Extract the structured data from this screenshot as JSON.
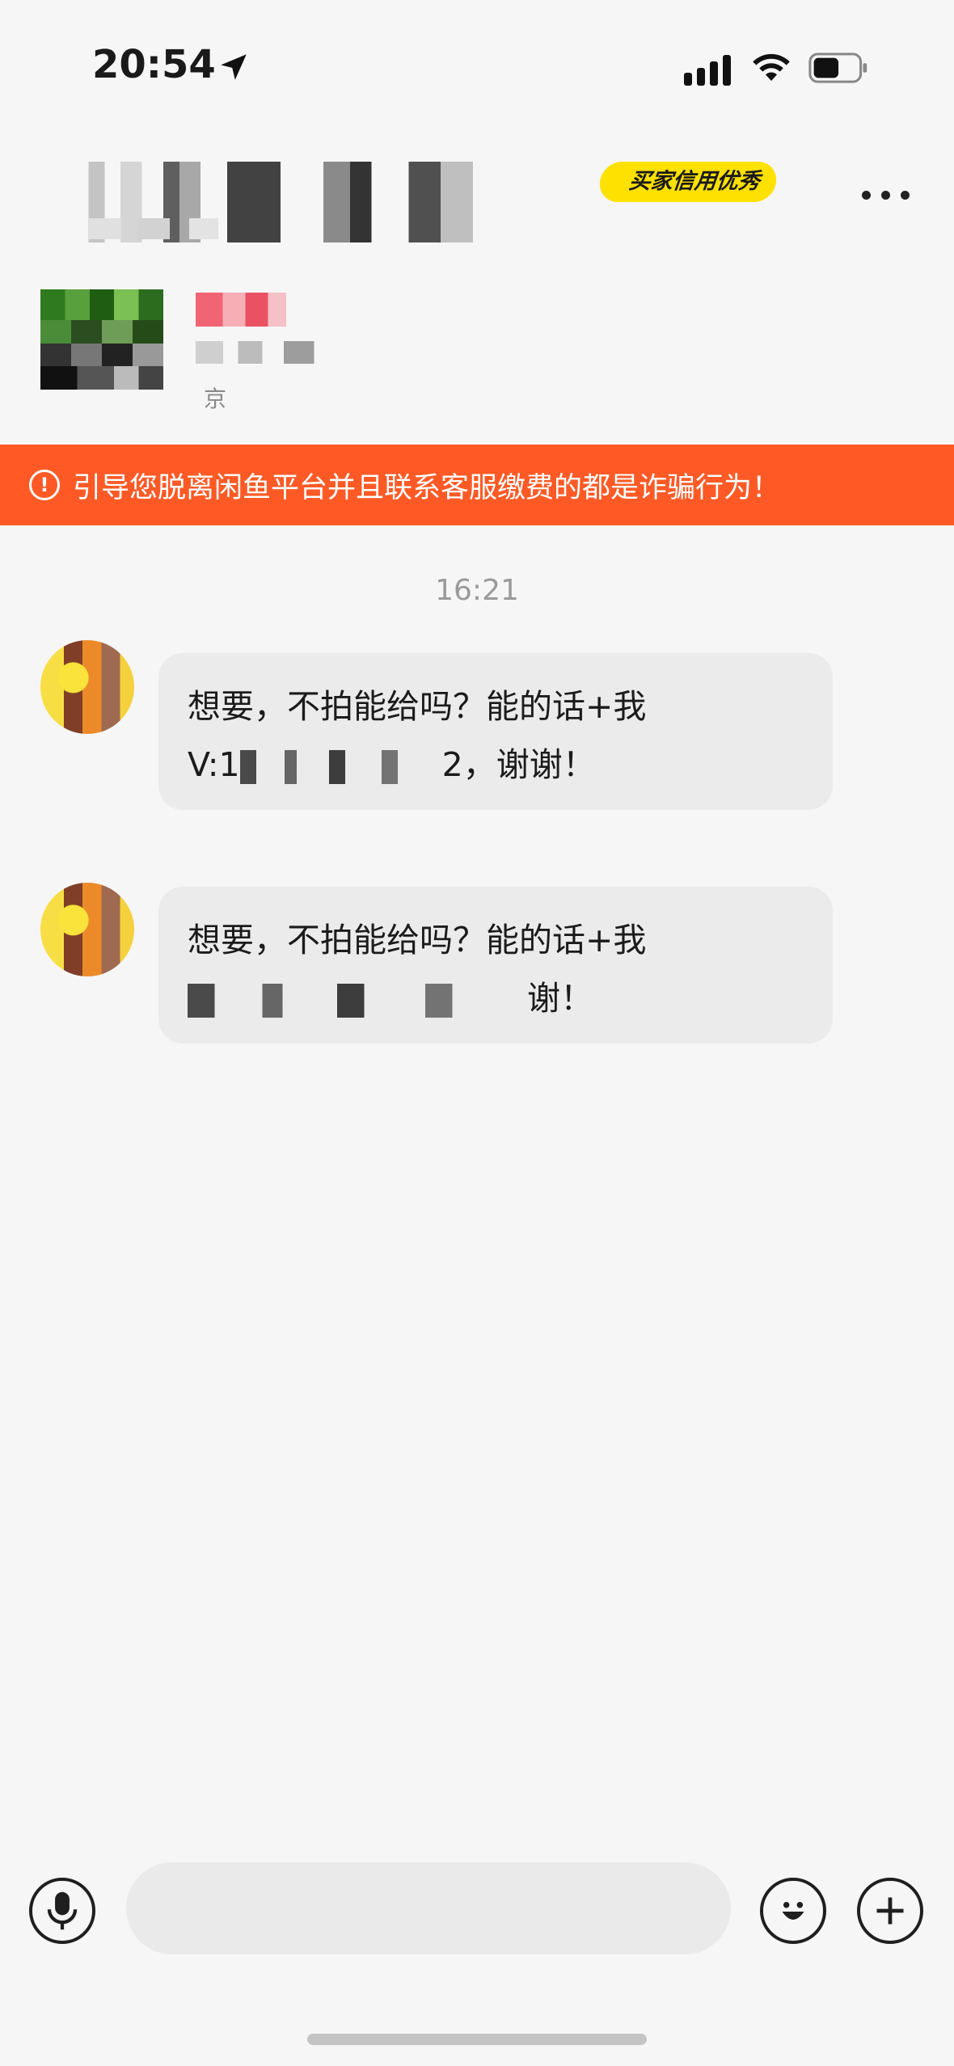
{
  "status_bar": {
    "time": "20:54",
    "icons": [
      "location-arrow-icon",
      "cellular-signal-icon",
      "wifi-icon",
      "battery-icon"
    ]
  },
  "header": {
    "badge": "买家信用优秀",
    "more_icon": "more-horizontal-icon"
  },
  "item": {
    "location": "京"
  },
  "fraud_warning": {
    "icon": "alert-circle-icon",
    "text": "引导您脱离闲鱼平台并且联系客服缴费的都是诈骗行为！"
  },
  "chat": {
    "timestamp": "16:21",
    "messages": [
      {
        "line1": "想要，不拍能给吗？能的话+我",
        "line2_prefix": "V:1",
        "line2_suffix": "2，谢谢！"
      },
      {
        "line1": "想要，不拍能给吗？能的话+我",
        "line2_suffix": "谢！"
      }
    ]
  },
  "input_bar": {
    "voice_icon": "microphone-icon",
    "input_value": "",
    "emoji_icon": "smiley-icon",
    "plus_icon": "plus-icon"
  },
  "colors": {
    "banner": "#ff5a26",
    "badge": "#ffe100",
    "background": "#f6f6f6",
    "bubble": "#ebebeb"
  }
}
